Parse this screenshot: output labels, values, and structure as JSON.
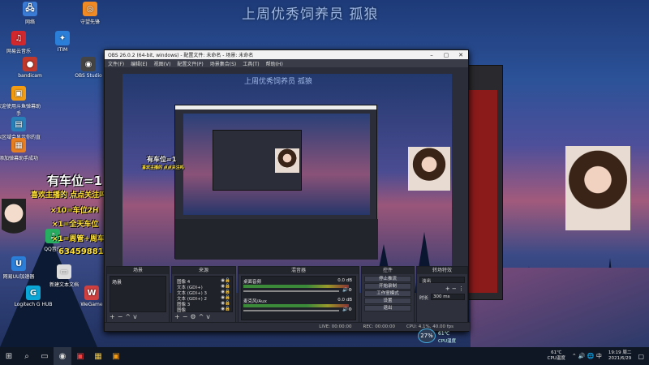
{
  "banner": "上周优秀饲养员 孤狼",
  "desktop_icons": [
    {
      "label": "网络",
      "glyph": "🖧",
      "color": "#3a7bd5"
    },
    {
      "label": "守望先锋",
      "glyph": "◎",
      "color": "#f08a24"
    },
    {
      "label": "网易云音乐",
      "glyph": "♫",
      "color": "#d0282d"
    },
    {
      "label": "ITIM",
      "glyph": "✦",
      "color": "#2b7fd8"
    },
    {
      "label": "bandicam",
      "glyph": "●",
      "color": "#c0392b"
    },
    {
      "label": "OBS Studio",
      "glyph": "◉",
      "color": "#444"
    },
    {
      "label": "欢迎使用斗鱼弹幕助手",
      "glyph": "▣",
      "color": "#f39c12"
    },
    {
      "label": "本区域会显示你的直播间",
      "glyph": "▤",
      "color": "#2980b9"
    },
    {
      "label": "添加弹幕助手成功",
      "glyph": "▦",
      "color": "#e67e22"
    },
    {
      "label": "QQ音乐",
      "glyph": "♪",
      "color": "#27ae60"
    },
    {
      "label": "网易UU加速器",
      "glyph": "U",
      "color": "#2b7fd8"
    },
    {
      "label": "新建文本文档",
      "glyph": "▭",
      "color": "#dddddd"
    },
    {
      "label": "Logitech G HUB",
      "glyph": "G",
      "color": "#0aa6d6"
    },
    {
      "label": "WeGame",
      "glyph": "W",
      "color": "#d04040"
    }
  ],
  "overlay": {
    "title": "有车位=1",
    "subtitle": "喜欢主播的 点点关注吗",
    "lines": [
      "×10=车位2H",
      "×1=全天车位",
      "×1=周管+周车位",
      "63459881"
    ]
  },
  "obs": {
    "window_title": "OBS 26.0.2 (64-bit, windows) - 配置文件: 未命名 - 场景: 未命名",
    "menu": [
      "文件(F)",
      "编辑(E)",
      "视图(V)",
      "配置文件(P)",
      "场景集合(S)",
      "工具(T)",
      "帮助(H)"
    ],
    "docks": {
      "scenes": {
        "title": "场景",
        "items": [
          "场景"
        ]
      },
      "sources": {
        "title": "来源",
        "items": [
          "图像 4",
          "文本 (GDI+)",
          "文本 (GDI+) 3",
          "文本 (GDI+) 2",
          "图像 3",
          "图像"
        ]
      },
      "mixer": {
        "title": "混音器",
        "channels": [
          {
            "name": "桌面音频",
            "db": "0.0 dB"
          },
          {
            "name": "麦克风/Aux",
            "db": "0.0 dB"
          }
        ]
      },
      "controls": {
        "title": "控件",
        "buttons": [
          "停止推流",
          "开始录制",
          "工作室模式",
          "设置",
          "退出"
        ]
      },
      "transitions": {
        "title": "转场特效",
        "type": "淡出",
        "duration_label": "时长",
        "duration": "300 ms"
      }
    },
    "status": {
      "live": "LIVE: 00:00:00",
      "rec": "REC: 00:00:00",
      "cpu": "CPU: 4.1%, 40.00 fps"
    }
  },
  "badge": {
    "percent": "27%",
    "temp": "61℃",
    "label": "CPU温度"
  },
  "taskbar": {
    "temp": "61℃",
    "temp_label": "CPU温度",
    "time": "19:19 周二",
    "date": "2021/6/29"
  },
  "colors": {
    "obs_bg": "#2b2e38",
    "accent": "#4ad"
  }
}
